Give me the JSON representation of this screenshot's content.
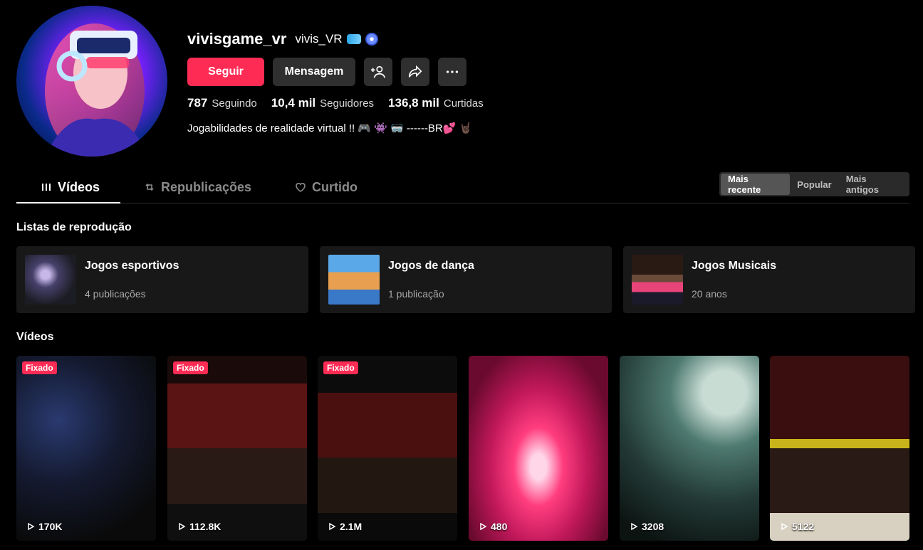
{
  "profile": {
    "username": "vivisgame_vr",
    "nickname": "vivis_VR",
    "bio": "Jogabilidades de realidade virtual !! 🎮 👾 🥽 ------BR💕 🤘🏿",
    "stats": [
      {
        "value": "787",
        "label": "Seguindo"
      },
      {
        "value": "10,4 mil",
        "label": "Seguidores"
      },
      {
        "value": "136,8 mil",
        "label": "Curtidas"
      }
    ]
  },
  "actions": {
    "follow": "Seguir",
    "message": "Mensagem"
  },
  "tabs": [
    {
      "label": "Vídeos",
      "icon": "grid-icon"
    },
    {
      "label": "Republicações",
      "icon": "repost-icon"
    },
    {
      "label": "Curtido",
      "icon": "heart-icon"
    }
  ],
  "sort": [
    "Mais recente",
    "Popular",
    "Mais antigos"
  ],
  "sections": {
    "playlists_title": "Listas de reprodução",
    "videos_title": "Vídeos"
  },
  "playlists": [
    {
      "name": "Jogos esportivos",
      "count": "4 publicações"
    },
    {
      "name": "Jogos de dança",
      "count": "1 publicação"
    },
    {
      "name": "Jogos Musicais",
      "count": "20 anos"
    }
  ],
  "videos": [
    {
      "pinned": "Fixado",
      "views": "170K"
    },
    {
      "pinned": "Fixado",
      "views": "112.8K"
    },
    {
      "pinned": "Fixado",
      "views": "2.1M"
    },
    {
      "pinned": "",
      "views": "480"
    },
    {
      "pinned": "",
      "views": "3208"
    },
    {
      "pinned": "",
      "views": "5122"
    }
  ],
  "colors": {
    "accent": "#fe2c55",
    "button": "#2f2f2f",
    "card": "#181818"
  }
}
